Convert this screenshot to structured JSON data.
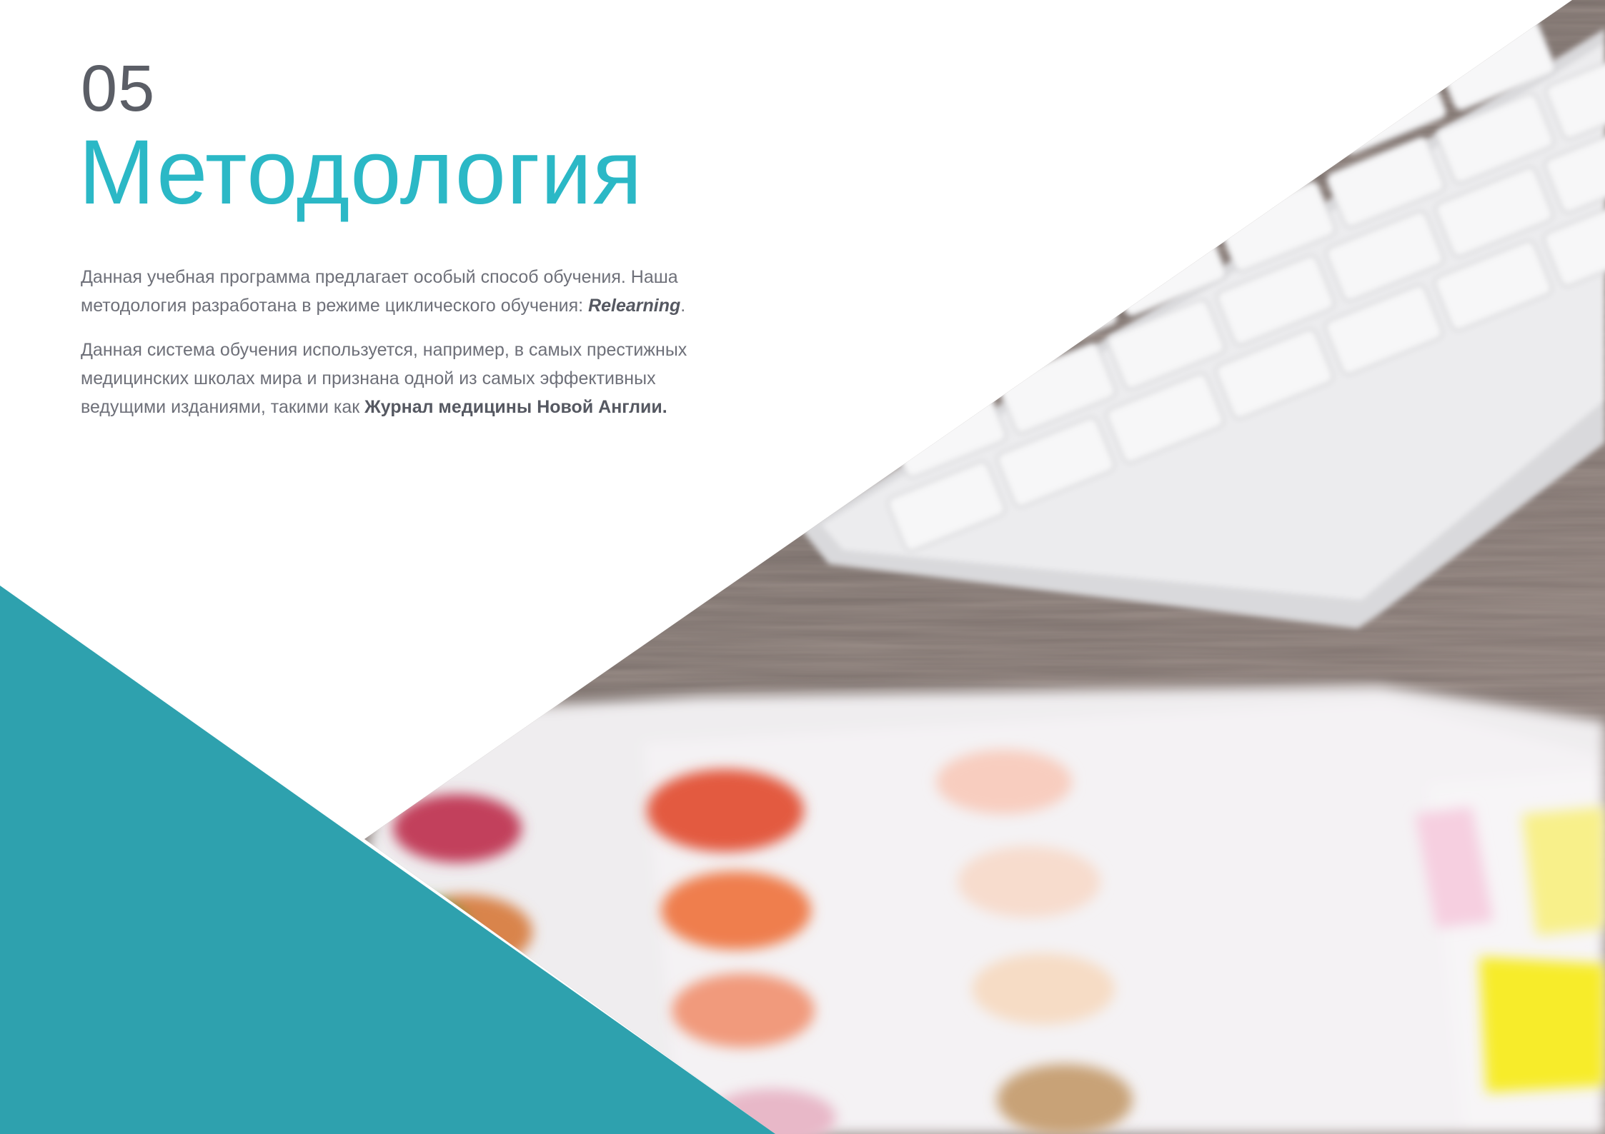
{
  "chapter": {
    "number": "05",
    "title": "Методология"
  },
  "intro": {
    "p1_text": "Данная учебная программа предлагает особый способ обучения. Наша методология разработана в режиме циклического обучения: ",
    "p1_emphasis": "Relearning",
    "p1_end": ".",
    "p2_text": "Данная система обучения используется, например, в самых престижных медицинских школах мира и признана одной из самых эффективных ведущими изданиями, такими как ",
    "p2_emphasis": "Журнал медицины Новой Англии."
  },
  "colors": {
    "accent": "#2bb8c6",
    "teal_triangle": "#1e9aa8",
    "heading_number": "#5b5e66",
    "body_text": "#6e7079"
  }
}
